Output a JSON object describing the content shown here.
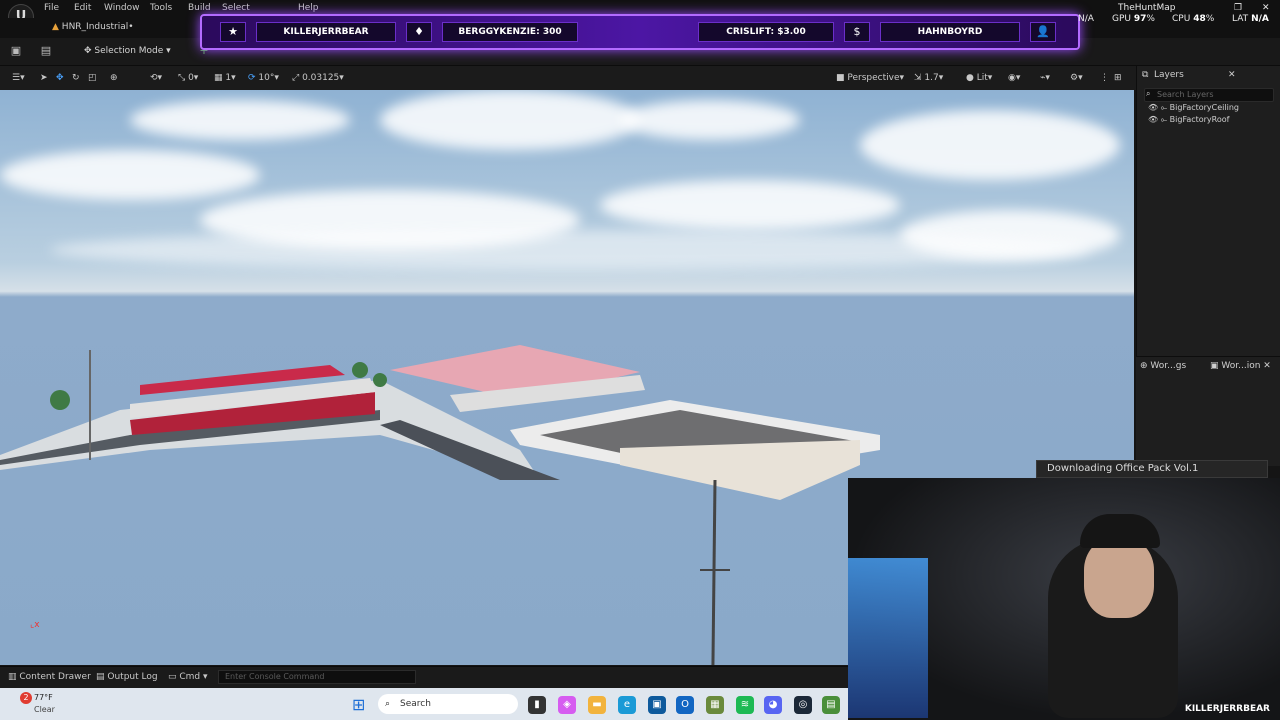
{
  "menu": [
    "File",
    "Edit",
    "Window",
    "Tools",
    "Build",
    "Select",
    "Help"
  ],
  "document_tab": "HNR_Industrial•",
  "project_name": "TheHuntMap",
  "toolbar": {
    "mode_label": "Selection Mode"
  },
  "viewport_toolbar": {
    "rotate_snap": "10°",
    "scale_snap": "0.03125",
    "grid_a": "0",
    "grid_b": "1",
    "view_mode": "Perspective",
    "camera_speed": "1.7",
    "lighting": "Lit"
  },
  "stats": {
    "gpu_label": "GPU",
    "gpu_value": "97",
    "cpu_label": "CPU",
    "cpu_value": "48",
    "lat_label": "LAT",
    "lat_value": "N/A",
    "na_left": "N/A"
  },
  "banner": {
    "item1": "KILLERJERRBEAR",
    "item2": "BERGGYKENZIE: 300",
    "item3": "CRISLIFT: $3.00",
    "item4": "HAHNBOYRD",
    "icons": [
      "★",
      "♦",
      "$",
      "👤"
    ]
  },
  "layers_panel": {
    "title": "Layers",
    "search_placeholder": "Search Layers",
    "items": [
      "BigFactoryCeiling",
      "BigFactoryRoof"
    ]
  },
  "world_tabs": [
    "Wor...gs",
    "Wor...ion"
  ],
  "download_notice": "Downloading Office Pack Vol.1",
  "webcam_name": "KILLERJERRBEAR",
  "bottom": {
    "content_drawer": "Content Drawer",
    "output_log": "Output Log",
    "cmd": "Cmd",
    "console_placeholder": "Enter Console Command"
  },
  "taskbar": {
    "weather_temp": "77°F",
    "weather_desc": "Clear",
    "search_label": "Search",
    "notification_count": "2"
  }
}
